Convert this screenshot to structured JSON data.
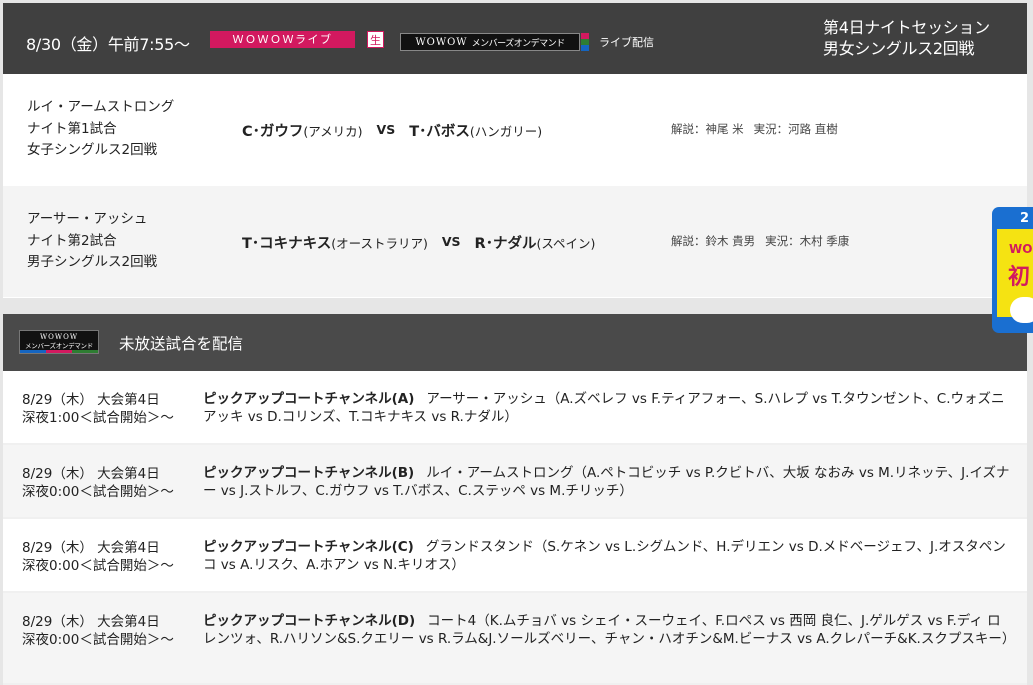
{
  "broadcast": {
    "date_time": "8/30（金）午前7:55～",
    "channel_badge": "ＷＯＷＯＷライブ",
    "live_badge": "生",
    "ondemand_logo_top": "WOWOW",
    "ondemand_logo_bottom": "メンバーズオンデマンド",
    "live_stream_label": "ライブ配信",
    "session_line1": "第4日ナイトセッション",
    "session_line2": "男女シングルス2回戦"
  },
  "matches": [
    {
      "court": "ルイ・アームストロング",
      "order": "ナイト第1試合",
      "event": "女子シングルス2回戦",
      "p1": "C･ガウフ",
      "p1_country": "(アメリカ)",
      "vs": "VS",
      "p2": "T･バボス",
      "p2_country": "(ハンガリー)",
      "commentary": "解説：神尾 米",
      "announcer": "実況：河路 直樹"
    },
    {
      "court": "アーサー・アッシュ",
      "order": "ナイト第2試合",
      "event": "男子シングルス2回戦",
      "p1": "T･コキナキス",
      "p1_country": "(オーストラリア)",
      "vs": "VS",
      "p2": "R･ナダル",
      "p2_country": "(スペイン)",
      "commentary": "解説：鈴木 貴男",
      "announcer": "実況：木村 季康"
    }
  ],
  "ondemand": {
    "logo_top": "WOWOW",
    "logo_bottom": "メンバーズオンデマンド",
    "title": "未放送試合を配信",
    "items": [
      {
        "when1": "8/29（木） 大会第4日",
        "when2": "深夜1:00＜試合開始＞～",
        "channel": "ピックアップコートチャンネル(A)",
        "detail": "アーサー・アッシュ（A.ズベレフ vs F.ティアフォー、S.ハレプ vs T.タウンゼント、C.ウォズニアッキ vs D.コリンズ、T.コキナキス vs R.ナダル）"
      },
      {
        "when1": "8/29（木） 大会第4日",
        "when2": "深夜0:00＜試合開始＞～",
        "channel": "ピックアップコートチャンネル(B)",
        "detail": "ルイ・アームストロング（A.ペトコビッチ vs P.クビトバ、大坂 なおみ vs M.リネッテ、J.イズナー vs J.ストルフ、C.ガウフ vs T.バボス、C.ステッペ vs M.チリッチ）"
      },
      {
        "when1": "8/29（木） 大会第4日",
        "when2": "深夜0:00＜試合開始＞～",
        "channel": "ピックアップコートチャンネル(C)",
        "detail": "グランドスタンド（S.ケネン vs L.シグムンド、H.デリエン vs D.メドベージェフ、J.オスタペンコ vs A.リスク、A.ホアン vs N.キリオス）"
      },
      {
        "when1": "8/29（木） 大会第4日",
        "when2": "深夜0:00＜試合開始＞～",
        "channel": "ピックアップコートチャンネル(D)",
        "detail": "コート4（K.ムチョバ vs シェイ・スーウェイ、F.ロペス vs 西岡 良仁、J.ゲルゲス vs F.ディ ロレンツォ、R.ハリソン&S.クエリー vs R.ラム&J.ソールズベリー、チャン・ハオチン&M.ビーナス vs A.クレパーチ&K.スクプスキー）"
      }
    ]
  },
  "side_banner": {
    "line1": "2",
    "line2": "WOW",
    "line3": "初"
  },
  "colors": {
    "header_bg": "#404040",
    "section_bg": "#4a4a4a",
    "accent_pink": "#d2195f",
    "banner_blue": "#1a6fd1",
    "banner_yellow": "#f5e312"
  }
}
